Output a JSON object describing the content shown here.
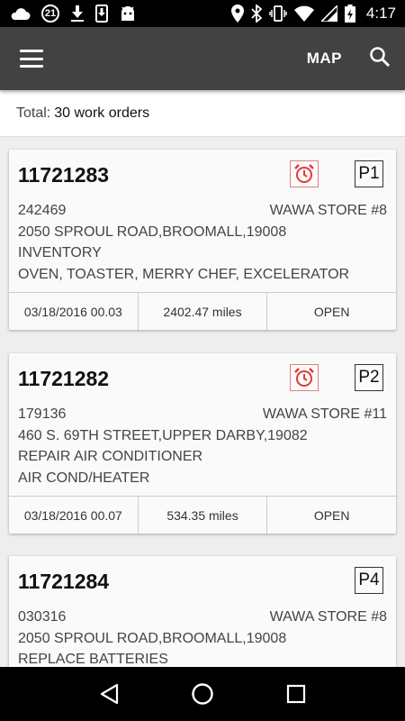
{
  "status_bar": {
    "notification_count": "21",
    "time": "4:17",
    "left_icons": [
      "cloud-icon",
      "notification-count-badge",
      "download-icon",
      "phone-download-icon",
      "android-icon"
    ],
    "right_icons": [
      "location-icon",
      "bluetooth-icon",
      "vibrate-icon",
      "wifi-icon",
      "signal-icon",
      "battery-charging-icon"
    ]
  },
  "toolbar": {
    "map_label": "MAP",
    "icons": [
      "menu-icon",
      "search-icon"
    ]
  },
  "summary": {
    "label": "Total:",
    "value": "30 work orders"
  },
  "work_orders": [
    {
      "number": "11721283",
      "has_alarm": true,
      "priority": "P1",
      "code": "242469",
      "store": "WAWA STORE #8",
      "address": "2050 SPROUL ROAD,BROOMALL,19008",
      "task": "INVENTORY",
      "equipment": "OVEN, TOASTER, MERRY CHEF, EXCELERATOR",
      "date": "03/18/2016 00.03",
      "distance": "2402.47 miles",
      "status": "OPEN"
    },
    {
      "number": "11721282",
      "has_alarm": true,
      "priority": "P2",
      "code": "179136",
      "store": "WAWA STORE #11",
      "address": "460 S. 69TH STREET,UPPER DARBY,19082",
      "task": "REPAIR AIR CONDITIONER",
      "equipment": "AIR COND/HEATER",
      "date": "03/18/2016 00.07",
      "distance": "534.35 miles",
      "status": "OPEN"
    },
    {
      "number": "11721284",
      "has_alarm": false,
      "priority": "P4",
      "code": "030316",
      "store": "WAWA STORE #8",
      "address": "2050 SPROUL ROAD,BROOMALL,19008",
      "task": "REPLACE BATTERIES"
    }
  ],
  "colors": {
    "toolbar": "#424242",
    "alarm": "#e53935",
    "background": "#eeeeee"
  },
  "nav_bar": {
    "icons": [
      "back-icon",
      "home-icon",
      "recents-icon"
    ]
  }
}
